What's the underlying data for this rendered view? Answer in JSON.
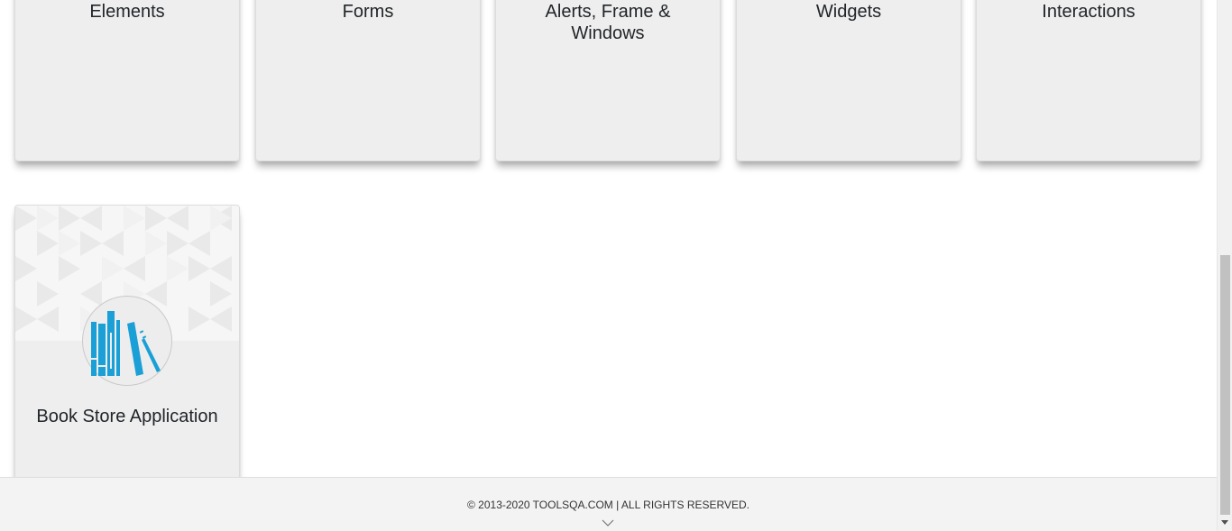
{
  "cards": [
    {
      "title": "Elements"
    },
    {
      "title": "Forms"
    },
    {
      "title": "Alerts, Frame & Windows"
    },
    {
      "title": "Widgets"
    },
    {
      "title": "Interactions"
    },
    {
      "title": "Book Store Application"
    }
  ],
  "footer": {
    "copyright": "© 2013-2020 TOOLSQA.COM | ALL RIGHTS RESERVED."
  },
  "colors": {
    "card_background": "#eeeeee",
    "book_icon": "#1a9fd6",
    "footer_background": "#f3f3f3"
  },
  "icons": {
    "book_store": "books-icon",
    "footer_scroll": "chevron-down-icon"
  }
}
